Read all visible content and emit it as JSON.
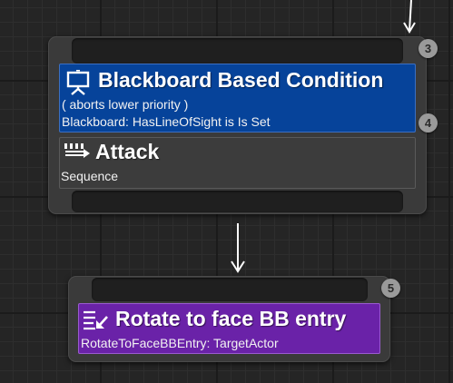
{
  "colors": {
    "decorator": "#06439a",
    "composite": "#3c3c3c",
    "task": "#6a22a8",
    "node_body": "#3a3a3a",
    "wire": "#ffffff"
  },
  "selector_node": {
    "execution_index": "3",
    "decorator": {
      "icon": "blackboard-icon",
      "title": "Blackboard Based Condition",
      "abort_mode": "( aborts lower priority )",
      "description": "Blackboard: HasLineOfSight is Is Set",
      "execution_index": "4"
    },
    "composite": {
      "icon": "sequence-icon",
      "title": "Attack",
      "type": "Sequence"
    }
  },
  "task_node": {
    "execution_index": "5",
    "icon": "rotate-task-icon",
    "title": "Rotate to face BB entry",
    "description": "RotateToFaceBBEntry: TargetActor"
  }
}
